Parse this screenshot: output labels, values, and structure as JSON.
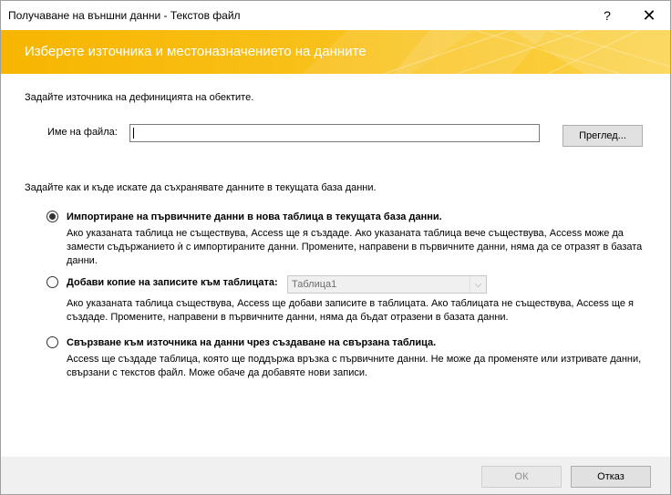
{
  "window": {
    "title": "Получаване на външни данни - Текстов файл",
    "help": "?",
    "close": "✕"
  },
  "banner": {
    "heading": "Изберете източника и местоназначението на данните"
  },
  "source": {
    "instruction": "Задайте източника на дефиницията на обектите.",
    "file_label": "Име на файла:",
    "file_value": "",
    "browse_label": "Преглед..."
  },
  "destination": {
    "instruction": "Задайте как и къде искате да съхранявате данните в текущата база данни.",
    "options": [
      {
        "label": "Импортиране на първичните данни в нова таблица в текущата база данни.",
        "description": "Ако указаната таблица не съществува, Access ще я създаде. Ако указаната таблица вече съществува, Access може да замести съдържанието ѝ с импортираните данни. Промените, направени в първичните данни, няма да се отразят в базата данни.",
        "checked": true
      },
      {
        "label": "Добави копие на записите към таблицата:",
        "description": "Ако указаната таблица съществува, Access ще добави записите в таблицата. Ако таблицата не съществува, Access ще я създаде. Промените, направени в първичните данни, няма да бъдат отразени в базата данни.",
        "checked": false,
        "table_value": "Таблица1"
      },
      {
        "label": "Свързване към източника на данни чрез създаване на свързана таблица.",
        "description": "Access ще създаде таблица, която ще поддържа връзка с първичните данни. Не може да променяте или изтривате данни, свързани с текстов файл. Може обаче да добавяте нови записи.",
        "checked": false
      }
    ]
  },
  "footer": {
    "ok_label": "ОК",
    "cancel_label": "Отказ"
  },
  "colors": {
    "banner": "#f7b500",
    "banner_text": "#ffffff",
    "footer_bg": "#f0f0f0"
  }
}
